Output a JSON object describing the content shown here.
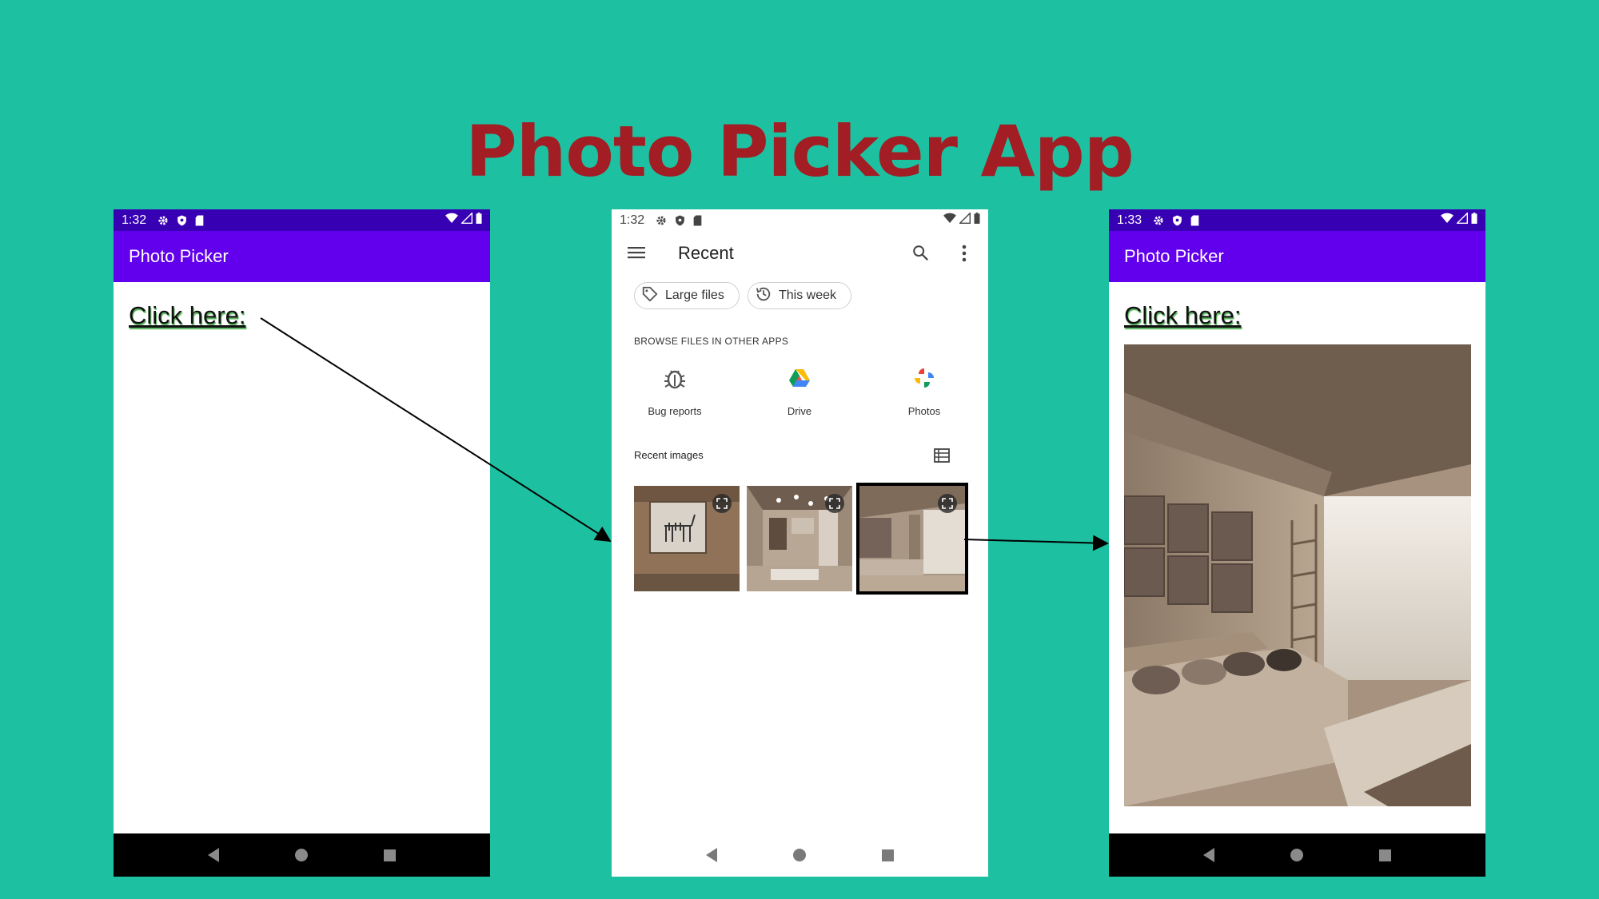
{
  "title": "Photo Picker App",
  "phone_left": {
    "status_time": "1:32",
    "app_title": "Photo Picker",
    "link_text": "Click here:"
  },
  "phone_middle": {
    "status_time": "1:32",
    "toolbar_title": "Recent",
    "chips": [
      "Large files",
      "This week"
    ],
    "browse_header": "BROWSE FILES IN OTHER APPS",
    "apps": [
      "Bug reports",
      "Drive",
      "Photos"
    ],
    "recent_header": "Recent images",
    "thumbnails": [
      "zebra-painting-room",
      "modern-kitchen-room",
      "living-room-sofa"
    ]
  },
  "phone_right": {
    "status_time": "1:33",
    "app_title": "Photo Picker",
    "link_text": "Click here:"
  },
  "colors": {
    "background": "#1dc1a1",
    "title": "#a21d24",
    "status_bar": "#3700b3",
    "app_bar": "#6200ee"
  }
}
